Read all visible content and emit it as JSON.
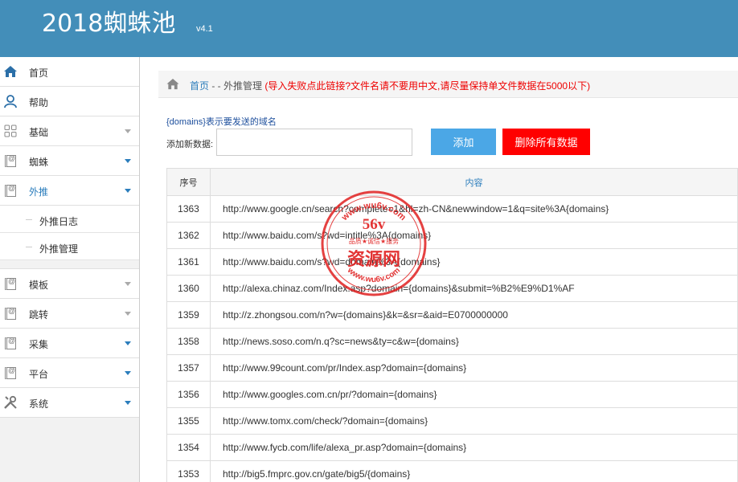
{
  "header": {
    "title": "2018蜘蛛池",
    "version": "v4.1"
  },
  "sidebar": {
    "items": [
      {
        "label": "首页",
        "icon": "home-icon",
        "caret": "none"
      },
      {
        "label": "帮助",
        "icon": "user-icon",
        "caret": "none"
      },
      {
        "label": "基础",
        "icon": "grid-icon",
        "caret": "gray"
      },
      {
        "label": "蜘蛛",
        "icon": "book-icon",
        "caret": "blue"
      },
      {
        "label": "外推",
        "icon": "book-icon",
        "caret": "blue",
        "active": true
      },
      {
        "label": "模板",
        "icon": "book-icon",
        "caret": "gray"
      },
      {
        "label": "跳转",
        "icon": "book-icon",
        "caret": "gray"
      },
      {
        "label": "采集",
        "icon": "book-icon",
        "caret": "blue"
      },
      {
        "label": "平台",
        "icon": "book-icon",
        "caret": "blue"
      },
      {
        "label": "系统",
        "icon": "tools-icon",
        "caret": "blue"
      }
    ],
    "submenu": [
      {
        "label": "外推日志"
      },
      {
        "label": "外推管理"
      }
    ]
  },
  "breadcrumb": {
    "home": "首页",
    "sep": " - - ",
    "current": "外推管理",
    "note": "(导入失败点此链接?文件名请不要用中文,请尽量保持单文件数据在5000以下)"
  },
  "form": {
    "hint": "{domains}表示要发送的域名",
    "label": "添加新数据:",
    "value": "",
    "add_button": "添加",
    "delete_button": "删除所有数据"
  },
  "table": {
    "headers": [
      "序号",
      "内容"
    ],
    "rows": [
      [
        "1363",
        "http://www.google.cn/search?complete=1&hl=zh-CN&newwindow=1&q=site%3A{domains}"
      ],
      [
        "1362",
        "http://www.baidu.com/s?wd=intitle%3A{domains}"
      ],
      [
        "1361",
        "http://www.baidu.com/s?wd=domain%3A{domains}"
      ],
      [
        "1360",
        "http://alexa.chinaz.com/Index.asp?domain={domains}&submit=%B2%E9%D1%AF"
      ],
      [
        "1359",
        "http://z.zhongsou.com/n?w={domains}&k=&sr=&aid=E0700000000"
      ],
      [
        "1358",
        "http://news.soso.com/n.q?sc=news&ty=c&w={domains}"
      ],
      [
        "1357",
        "http://www.99count.com/pr/Index.asp?domain={domains}"
      ],
      [
        "1356",
        "http://www.googles.com.cn/pr/?domain={domains}"
      ],
      [
        "1355",
        "http://www.tomx.com/check/?domain={domains}"
      ],
      [
        "1354",
        "http://www.fycb.com/life/alexa_pr.asp?domain={domains}"
      ],
      [
        "1353",
        "http://big5.fmprc.gov.cn/gate/big5/{domains}"
      ]
    ]
  },
  "watermark": {
    "url_top": "www.wu6v.com",
    "brand": "56v",
    "slogan": "品质★诚信★服务",
    "name": "资源网",
    "url_bottom": "www.wu6v.com"
  },
  "colors": {
    "header": "#438eb9",
    "link": "#2b7dbc",
    "note": "#ee0000",
    "add": "#4ba7e6",
    "delete": "#ff0000",
    "stamp": "#e02020"
  }
}
